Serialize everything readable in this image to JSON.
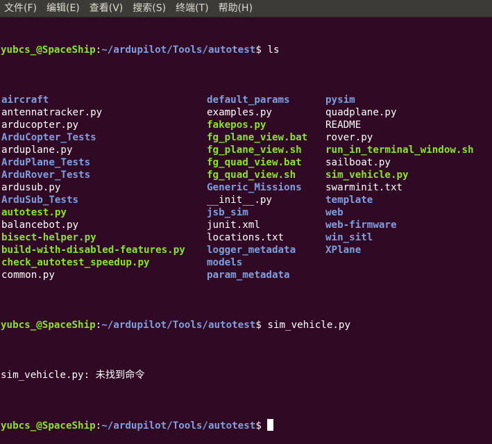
{
  "menubar": {
    "items": [
      "文件(F)",
      "编辑(E)",
      "查看(V)",
      "搜索(S)",
      "终端(T)",
      "帮助(H)"
    ]
  },
  "prompt": {
    "user_host": "yubcs_@SpaceShip",
    "sep": ":",
    "path": "~/ardupilot/Tools/autotest",
    "symbol": "$"
  },
  "commands": [
    " ls",
    " sim_vehicle.py"
  ],
  "ls_columns": [
    [
      {
        "name": "aircraft",
        "type": "dir"
      },
      {
        "name": "antennatracker.py",
        "type": "plain"
      },
      {
        "name": "arducopter.py",
        "type": "plain"
      },
      {
        "name": "ArduCopter_Tests",
        "type": "dir"
      },
      {
        "name": "arduplane.py",
        "type": "plain"
      },
      {
        "name": "ArduPlane_Tests",
        "type": "dir"
      },
      {
        "name": "ArduRover_Tests",
        "type": "dir"
      },
      {
        "name": "ardusub.py",
        "type": "plain"
      },
      {
        "name": "ArduSub_Tests",
        "type": "dir"
      },
      {
        "name": "autotest.py",
        "type": "exec"
      },
      {
        "name": "balancebot.py",
        "type": "plain"
      },
      {
        "name": "bisect-helper.py",
        "type": "exec"
      },
      {
        "name": "build-with-disabled-features.py",
        "type": "exec"
      },
      {
        "name": "check_autotest_speedup.py",
        "type": "exec"
      },
      {
        "name": "common.py",
        "type": "plain"
      }
    ],
    [
      {
        "name": "default_params",
        "type": "dir"
      },
      {
        "name": "examples.py",
        "type": "plain"
      },
      {
        "name": "fakepos.py",
        "type": "exec"
      },
      {
        "name": "fg_plane_view.bat",
        "type": "exec"
      },
      {
        "name": "fg_plane_view.sh",
        "type": "exec"
      },
      {
        "name": "fg_quad_view.bat",
        "type": "exec"
      },
      {
        "name": "fg_quad_view.sh",
        "type": "exec"
      },
      {
        "name": "Generic_Missions",
        "type": "dir"
      },
      {
        "name": "__init__.py",
        "type": "plain"
      },
      {
        "name": "jsb_sim",
        "type": "dir"
      },
      {
        "name": "junit.xml",
        "type": "plain"
      },
      {
        "name": "locations.txt",
        "type": "plain"
      },
      {
        "name": "logger_metadata",
        "type": "dir"
      },
      {
        "name": "models",
        "type": "dir"
      },
      {
        "name": "param_metadata",
        "type": "dir"
      }
    ],
    [
      {
        "name": "pysim",
        "type": "dir"
      },
      {
        "name": "quadplane.py",
        "type": "plain"
      },
      {
        "name": "README",
        "type": "plain"
      },
      {
        "name": "rover.py",
        "type": "plain"
      },
      {
        "name": "run_in_terminal_window.sh",
        "type": "exec"
      },
      {
        "name": "sailboat.py",
        "type": "plain"
      },
      {
        "name": "sim_vehicle.py",
        "type": "exec"
      },
      {
        "name": "swarminit.txt",
        "type": "plain"
      },
      {
        "name": "template",
        "type": "dir"
      },
      {
        "name": "web",
        "type": "dir"
      },
      {
        "name": "web-firmware",
        "type": "dir"
      },
      {
        "name": "win_sitl",
        "type": "dir"
      },
      {
        "name": "XPlane",
        "type": "dir"
      }
    ]
  ],
  "error_output": "sim_vehicle.py: 未找到命令",
  "colors": {
    "background": "#300a24",
    "menubar": "#3c3b37",
    "dir": "#7f9fdf",
    "exec": "#8ae234",
    "text": "#ffffff"
  }
}
